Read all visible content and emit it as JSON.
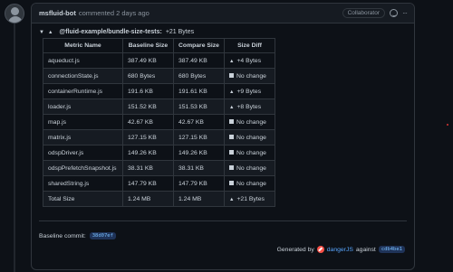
{
  "comment": {
    "author": "msfluid-bot",
    "action": "commented 2 days ago",
    "badge": "Collaborator",
    "menu_glyph": "···"
  },
  "summary": {
    "title": "@fluid-example/bundle-size-tests:",
    "delta": "+21 Bytes"
  },
  "table": {
    "headers": [
      "Metric Name",
      "Baseline Size",
      "Compare Size",
      "Size Diff"
    ],
    "rows": [
      {
        "name": "aqueduct.js",
        "base": "387.49 KB",
        "comp": "387.49 KB",
        "diff": "+4 Bytes",
        "kind": "up"
      },
      {
        "name": "connectionState.js",
        "base": "680 Bytes",
        "comp": "680 Bytes",
        "diff": "No change",
        "kind": "same"
      },
      {
        "name": "containerRuntime.js",
        "base": "191.6 KB",
        "comp": "191.61 KB",
        "diff": "+9 Bytes",
        "kind": "up"
      },
      {
        "name": "loader.js",
        "base": "151.52 KB",
        "comp": "151.53 KB",
        "diff": "+8 Bytes",
        "kind": "up"
      },
      {
        "name": "map.js",
        "base": "42.67 KB",
        "comp": "42.67 KB",
        "diff": "No change",
        "kind": "same"
      },
      {
        "name": "matrix.js",
        "base": "127.15 KB",
        "comp": "127.15 KB",
        "diff": "No change",
        "kind": "same"
      },
      {
        "name": "odspDriver.js",
        "base": "149.26 KB",
        "comp": "149.26 KB",
        "diff": "No change",
        "kind": "same"
      },
      {
        "name": "odspPrefetchSnapshot.js",
        "base": "38.31 KB",
        "comp": "38.31 KB",
        "diff": "No change",
        "kind": "same"
      },
      {
        "name": "sharedString.js",
        "base": "147.79 KB",
        "comp": "147.79 KB",
        "diff": "No change",
        "kind": "same"
      },
      {
        "name": "Total Size",
        "base": "1.24 MB",
        "comp": "1.24 MB",
        "diff": "+21 Bytes",
        "kind": "up"
      }
    ]
  },
  "footer": {
    "baseline_label": "Baseline commit:",
    "baseline_sha": "38d07ef",
    "generated_by": "Generated by",
    "danger_link": "dangerJS",
    "against": "against",
    "against_sha": "cdb4be1"
  },
  "colors": {
    "background": "#0d1117",
    "border": "#30363d",
    "link": "#58a6ff",
    "sha_bg": "#1f3358",
    "danger": "#f85149"
  }
}
